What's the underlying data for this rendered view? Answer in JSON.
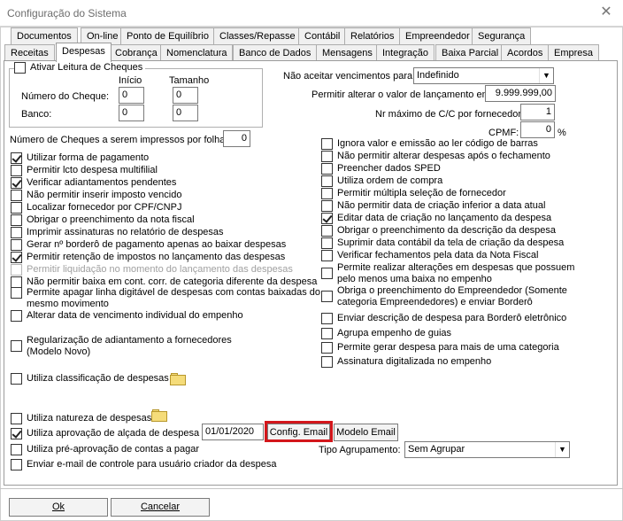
{
  "window": {
    "title": "Configuração do Sistema",
    "close_glyph": "✕"
  },
  "tabs_row1": [
    "Documentos",
    "On-line",
    "Ponto de Equilíbrio",
    "Classes/Repasse",
    "Contábil",
    "Relatórios",
    "Empreendedor",
    "Segurança"
  ],
  "tabs_row2": [
    "Receitas",
    "Despesas",
    "Cobrança",
    "Nomenclatura",
    "Banco de Dados",
    "Mensagens",
    "Integração",
    "Baixa Parcial",
    "Acordos",
    "Empresa"
  ],
  "active_tab": "Despesas",
  "cheques": {
    "group_label": "Ativar Leitura de Cheques",
    "col_inicio": "Início",
    "col_tamanho": "Tamanho",
    "numero_label": "Número do Cheque:",
    "numero_inicio": "0",
    "numero_tamanho": "0",
    "banco_label": "Banco:",
    "banco_inicio": "0",
    "banco_tamanho": "0"
  },
  "right_top": {
    "nao_aceitar_label": "Não aceitar vencimentos para:",
    "nao_aceitar_value": "Indefinido",
    "permitir_alterar_label": "Permitir alterar o valor de lançamento em:",
    "permitir_alterar_value": "9.999.999,00",
    "nr_maximo_label": "Nr máximo de C/C por fornecedor:",
    "nr_maximo_value": "1",
    "cpmf_label": "CPMF:",
    "cpmf_value": "0",
    "cpmf_unit": "%"
  },
  "num_cheques": {
    "label": "Número de Cheques a serem impressos por folha:",
    "value": "0"
  },
  "left_checks": [
    {
      "label": "Utilizar forma de pagamento",
      "checked": true
    },
    {
      "label": "Permitir lcto despesa multifilial",
      "checked": false
    },
    {
      "label": "Verificar adiantamentos pendentes",
      "checked": true
    },
    {
      "label": "Não permitir inserir imposto vencido",
      "checked": false
    },
    {
      "label": "Localizar fornecedor por CPF/CNPJ",
      "checked": false
    },
    {
      "label": "Obrigar o preenchimento da nota fiscal",
      "checked": false
    },
    {
      "label": "Imprimir assinaturas no relatório de despesas",
      "checked": false
    },
    {
      "label": "Gerar nº borderô de pagamento apenas ao baixar despesas",
      "checked": false
    },
    {
      "label": "Permitir retenção de impostos no lançamento das despesas",
      "checked": true
    },
    {
      "label": "Permitir liquidação no momento do lançamento das despesas",
      "checked": false,
      "disabled": true
    },
    {
      "label": "Não permitir baixa em cont. corr. de categoria diferente da despesa",
      "checked": false
    },
    {
      "label": "Permite apagar linha digitável de despesas com contas baixadas do",
      "label2": "mesmo movimento",
      "checked": false
    },
    {
      "label": "Alterar data de vencimento individual do empenho",
      "checked": false
    },
    {
      "label": "Regularização de adiantamento a fornecedores",
      "label2": "(Modelo Novo)",
      "checked": false
    },
    {
      "label": "Utiliza classificação de despesas",
      "checked": false
    }
  ],
  "right_checks": [
    {
      "label": "Ignora valor e emissão ao ler código de barras",
      "checked": false
    },
    {
      "label": "Não permitir alterar despesas após o fechamento",
      "checked": false
    },
    {
      "label": "Preencher dados SPED",
      "checked": false
    },
    {
      "label": "Utiliza ordem de compra",
      "checked": false
    },
    {
      "label": "Permitir múltipla seleção de fornecedor",
      "checked": false
    },
    {
      "label": "Não permitir data de criação inferior a data atual",
      "checked": false
    },
    {
      "label": "Editar data de criação no lançamento da despesa",
      "checked": true
    },
    {
      "label": "Obrigar o preenchimento da descrição da despesa",
      "checked": false
    },
    {
      "label": "Suprimir data contábil da tela de criação da despesa",
      "checked": false
    },
    {
      "label": "Verificar fechamentos pela data da Nota Fiscal",
      "checked": false
    },
    {
      "label": "Permite realizar alterações em despesas que possuem",
      "label2": "pelo menos uma baixa no empenho",
      "checked": false
    },
    {
      "label": "Obriga o preenchimento do Empreendedor (Somente",
      "label2": "categoria Empreendedores) e enviar Borderô",
      "checked": false
    },
    {
      "label": "Enviar descrição de despesa para Borderô eletrônico",
      "checked": false
    },
    {
      "label": "Agrupa empenho de guias",
      "checked": false
    },
    {
      "label": "Permite gerar despesa para mais de uma categoria",
      "checked": false
    },
    {
      "label": "Assinatura digitalizada no empenho",
      "checked": false
    }
  ],
  "bottom_checks": {
    "natureza": {
      "label": "Utiliza natureza de despesas",
      "checked": false
    },
    "aprovacao": {
      "label": "Utiliza aprovação de alçada de despesa",
      "checked": true,
      "date": "01/01/2020"
    },
    "pre_aprovacao": {
      "label": "Utiliza pré-aprovação de contas a pagar",
      "checked": false
    },
    "enviar_email": {
      "label": "Enviar e-mail de controle para usuário criador da despesa",
      "checked": false
    }
  },
  "buttons": {
    "config_email": "Config. Email",
    "modelo_email": "Modelo Email",
    "ok": "Ok",
    "cancelar": "Cancelar"
  },
  "tipo_agrupamento": {
    "label": "Tipo Agrupamento:",
    "value": "Sem Agrupar"
  },
  "icons": {
    "folder": "folder-icon",
    "dropdown": "chevron-down-icon",
    "highlight_color": "#d3161b"
  }
}
